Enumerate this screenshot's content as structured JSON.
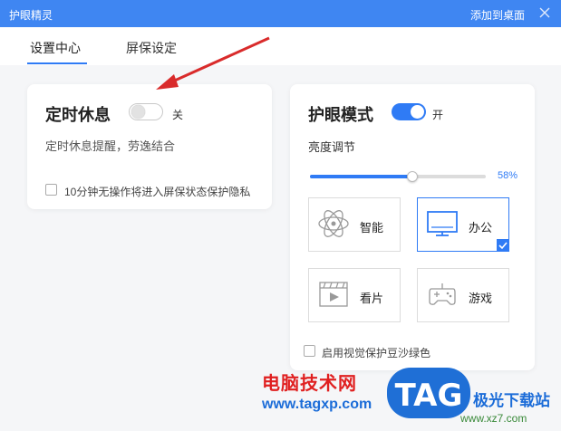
{
  "window": {
    "title": "护眼精灵",
    "add_to_desktop": "添加到桌面"
  },
  "tabs": [
    {
      "label": "设置中心",
      "active": true
    },
    {
      "label": "屏保设定",
      "active": false
    }
  ],
  "rest_card": {
    "title": "定时休息",
    "toggle_on": false,
    "toggle_label": "关",
    "description": "定时休息提醒，劳逸结合",
    "checkbox_label": "10分钟无操作将进入屏保状态保护隐私",
    "checkbox_checked": false
  },
  "eye_card": {
    "title": "护眼模式",
    "toggle_on": true,
    "toggle_label": "开",
    "brightness_label": "亮度调节",
    "brightness_value": "58%",
    "brightness_level": 0.58,
    "modes": [
      {
        "label": "智能",
        "icon": "atom-icon",
        "selected": false
      },
      {
        "label": "办公",
        "icon": "monitor-icon",
        "selected": true
      },
      {
        "label": "看片",
        "icon": "film-icon",
        "selected": false
      },
      {
        "label": "游戏",
        "icon": "gamepad-icon",
        "selected": false
      }
    ],
    "bean_green_label": "启用视觉保护豆沙绿色",
    "bean_green_checked": false
  },
  "watermark": {
    "left_title": "电脑技术网",
    "left_url": "www.tagxp.com",
    "logo_text": "TAG",
    "right_title": "极光下载站",
    "right_url": "www.xz7.com"
  },
  "colors": {
    "titlebar": "#3f86f2",
    "accent": "#2f7bf5",
    "arrow": "#d92b2b"
  }
}
